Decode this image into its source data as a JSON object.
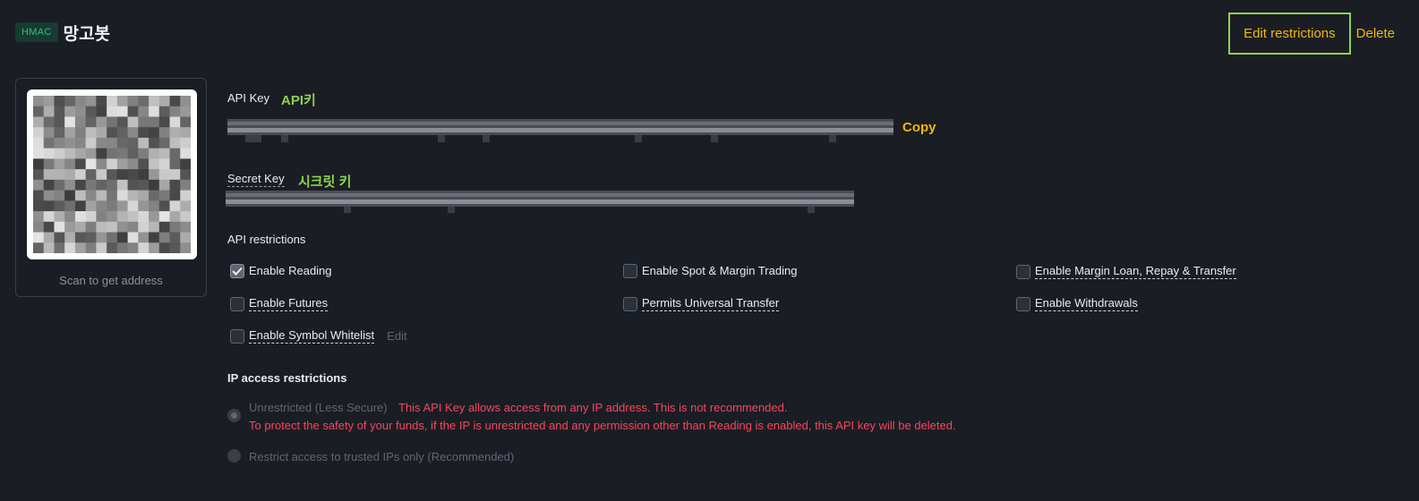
{
  "header": {
    "badge": "HMAC",
    "key_name": "망고봇"
  },
  "actions": {
    "edit_label": "Edit restrictions",
    "delete_label": "Delete"
  },
  "qr": {
    "caption": "Scan to get address"
  },
  "api_key": {
    "label": "API Key",
    "annotation": "API키",
    "copy_label": "Copy"
  },
  "secret_key": {
    "label": "Secret Key",
    "annotation": "시크릿 키"
  },
  "api_restrictions": {
    "title": "API restrictions",
    "options": [
      {
        "label": "Enable Reading",
        "checked": true
      },
      {
        "label": "Enable Spot & Margin Trading",
        "checked": false
      },
      {
        "label": "Enable Margin Loan, Repay & Transfer",
        "checked": false
      },
      {
        "label": "Enable Futures",
        "checked": false
      },
      {
        "label": "Permits Universal Transfer",
        "checked": false
      },
      {
        "label": "Enable Withdrawals",
        "checked": false
      },
      {
        "label": "Enable Symbol Whitelist",
        "checked": false
      }
    ],
    "whitelist_edit": "Edit"
  },
  "ip_restrictions": {
    "title": "IP access restrictions",
    "unrestricted_label": "Unrestricted (Less Secure)",
    "warning_line1": "This API Key allows access from any IP address. This is not recommended.",
    "warning_line2": "To protect the safety of your funds, if the IP is unrestricted and any permission other than Reading is enabled, this API key will be deleted.",
    "restricted_label": "Restrict access to trusted IPs only (Recommended)"
  },
  "colors": {
    "accent": "#f0b90b",
    "annotation": "#8cd44e",
    "warning": "#f6465d",
    "badge": "#2ebd85"
  }
}
